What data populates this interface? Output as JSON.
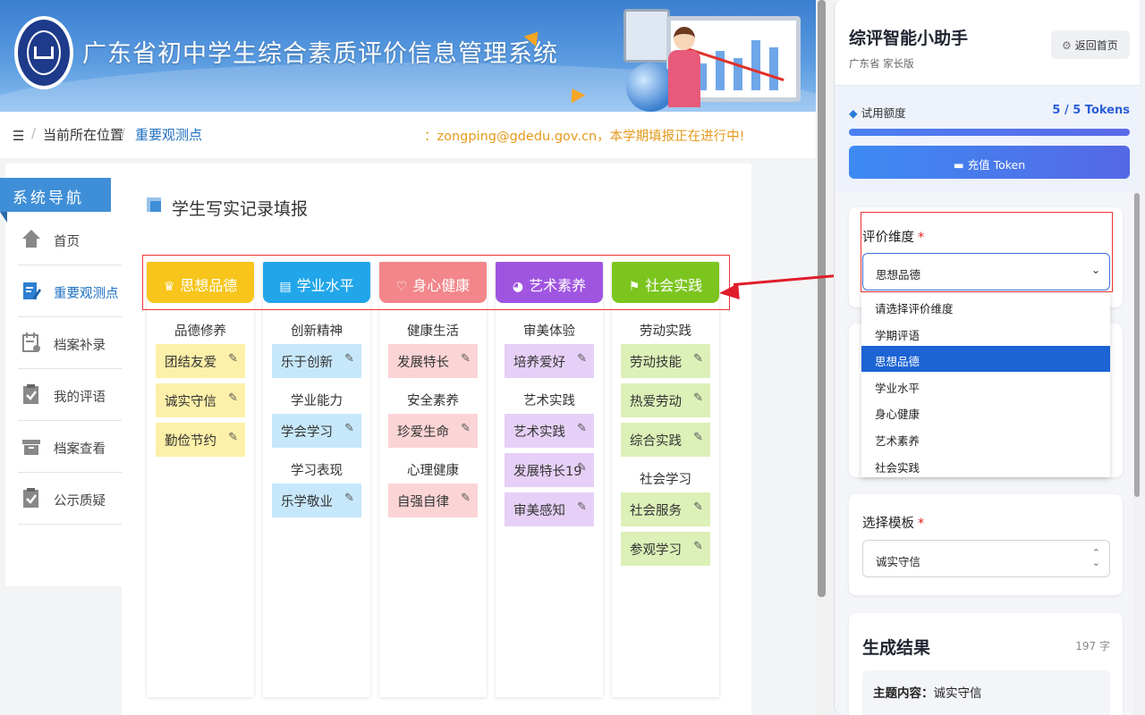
{
  "site": {
    "title": "广东省初中学生综合素质评价信息管理系统",
    "breadcrumb": {
      "menu_icon": "☰",
      "root": "当前所在位置",
      "current": "重要观测点"
    },
    "notice": "：zongping@gdedu.gov.cn，本学期填报正在进行中!",
    "nav": {
      "header": "系统导航",
      "items": [
        {
          "label": "首页",
          "icon": "home-icon"
        },
        {
          "label": "重要观测点",
          "icon": "edit-note-icon",
          "active": true
        },
        {
          "label": "档案补录",
          "icon": "calendar-icon"
        },
        {
          "label": "我的评语",
          "icon": "clipboard-check-icon"
        },
        {
          "label": "档案查看",
          "icon": "archive-box-icon"
        },
        {
          "label": "公示质疑",
          "icon": "clipboard-check-icon"
        }
      ]
    },
    "content_title": "学生写实记录填报",
    "columns": [
      {
        "title": "思想品德",
        "icon": "crown-icon",
        "glyph": "♛",
        "color": "#f7c51b",
        "chip_color": "#fdf0a8",
        "sections": [
          {
            "name": "品德修养",
            "items": [
              "团结友爱",
              "诚实守信",
              "勤俭节约"
            ]
          }
        ]
      },
      {
        "title": "学业水平",
        "icon": "book-icon",
        "glyph": "▤",
        "color": "#22a6ea",
        "chip_color": "#c7e8fb",
        "sections": [
          {
            "name": "创新精神",
            "items": [
              "乐于创新"
            ]
          },
          {
            "name": "学业能力",
            "items": [
              "学会学习"
            ]
          },
          {
            "name": "学习表现",
            "items": [
              "乐学敬业"
            ]
          }
        ]
      },
      {
        "title": "身心健康",
        "icon": "heart-pulse-icon",
        "glyph": "♡",
        "color": "#f2868a",
        "chip_color": "#fbd4d6",
        "sections": [
          {
            "name": "健康生活",
            "items": [
              "发展特长"
            ]
          },
          {
            "name": "安全素养",
            "items": [
              "珍爱生命"
            ]
          },
          {
            "name": "心理健康",
            "items": [
              "自强自律"
            ]
          }
        ]
      },
      {
        "title": "艺术素养",
        "icon": "palette-icon",
        "glyph": "◕",
        "color": "#a055e0",
        "chip_color": "#e6d0f7",
        "sections": [
          {
            "name": "审美体验",
            "items": [
              "培养爱好"
            ]
          },
          {
            "name": "艺术实践",
            "items": [
              "艺术实践",
              "发展特长19",
              "审美感知"
            ]
          }
        ]
      },
      {
        "title": "社会实践",
        "icon": "flag-icon",
        "glyph": "⚑",
        "color": "#7cc51f",
        "chip_color": "#dcf0b8",
        "sections": [
          {
            "name": "劳动实践",
            "items": [
              "劳动技能",
              "热爱劳动",
              "综合实践"
            ]
          },
          {
            "name": "社会学习",
            "items": [
              "社会服务",
              "参观学习"
            ]
          }
        ]
      }
    ],
    "edit_glyph": "✎"
  },
  "panel": {
    "title": "综评智能小助手",
    "subtitle": "广东省 家长版",
    "back_label": "返回首页",
    "back_icon": "⚙",
    "quota": {
      "label": "试用额度",
      "gem": "◆",
      "value": "5 / 5 Tokens",
      "fill_fraction": 1.0
    },
    "recharge_label": "▬ 充值 Token",
    "dimension": {
      "label": "评价维度",
      "required_mark": "*",
      "value": "思想品德",
      "chevron": "⌄",
      "options": [
        "请选择评价维度",
        "学期评语",
        "思想品德",
        "学业水平",
        "身心健康",
        "艺术素养",
        "社会实践"
      ],
      "selected_index": 2
    },
    "template": {
      "label": "选择模板",
      "required_mark": "*",
      "value": "诚实守信",
      "chevron": "⌃⌄"
    },
    "result": {
      "title": "生成结果",
      "count": "197 字",
      "topic_label": "主题内容：",
      "topic_value": "诚实守信"
    }
  },
  "colors": {
    "accent": "#3b6fd4",
    "highlight": "#e11d2a",
    "nav_header": "#3f8fd8"
  }
}
